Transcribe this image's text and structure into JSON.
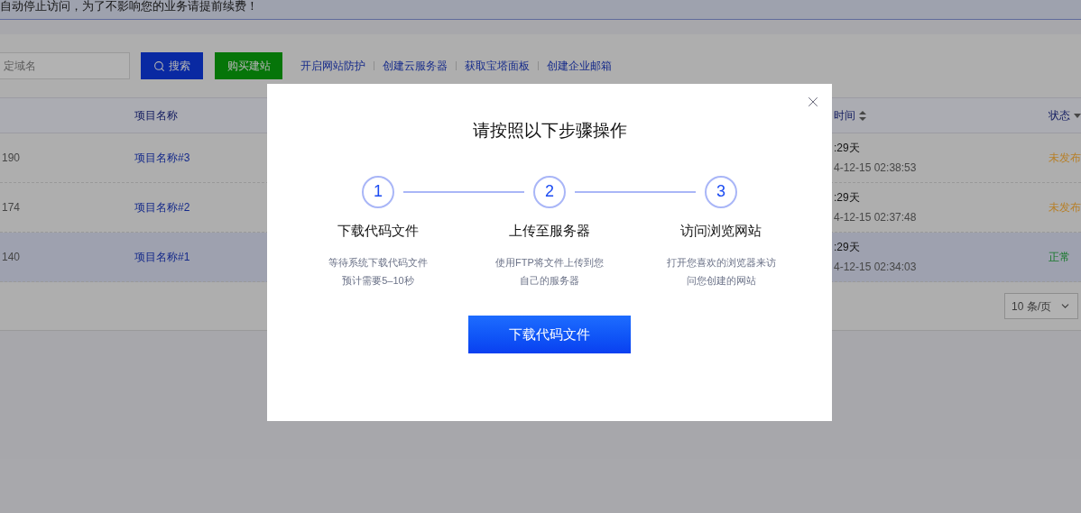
{
  "notice": {
    "text": "自动停止访问，为了不影响您的业务请提前续费！"
  },
  "toolbar": {
    "search": {
      "placeholder": "定域名"
    },
    "search_button": "搜索",
    "buy_button": "购买建站",
    "links": [
      "开启网站防护",
      "创建云服务器",
      "获取宝塔面板",
      "创建企业邮箱"
    ]
  },
  "table": {
    "columns": [
      {
        "label": "项目名称",
        "kind": "plain"
      },
      {
        "label": "时间",
        "kind": "sort"
      },
      {
        "label": "状态",
        "kind": "filter"
      }
    ],
    "rows": [
      {
        "id": "190",
        "name": "项目名称#3",
        "duration": ":29天",
        "created": "4-12-15 02:38:53",
        "status": "未发布",
        "color": "#b7812b",
        "selected": false
      },
      {
        "id": "174",
        "name": "项目名称#2",
        "duration": ":29天",
        "created": "4-12-15 02:37:48",
        "status": "未发布",
        "color": "#b7812b",
        "selected": false
      },
      {
        "id": "140",
        "name": "项目名称#1",
        "duration": ":29天",
        "created": "4-12-15 02:34:03",
        "status": "正常",
        "color": "#17782b",
        "selected": true
      }
    ]
  },
  "pagination": {
    "page_size": "10 条/页"
  },
  "dialog": {
    "title": "请按照以下步骤操作",
    "steps": [
      {
        "number": "1",
        "title": "下载代码文件",
        "lines": [
          "等待系统下载代码文件",
          "预计需要5–10秒"
        ]
      },
      {
        "number": "2",
        "title": "上传至服务器",
        "lines": [
          "使用FTP将文件上传到您",
          "自己的服务器"
        ]
      },
      {
        "number": "3",
        "title": "访问浏览网站",
        "lines": [
          "打开您喜欢的浏览器来访",
          "问您创建的网站"
        ]
      }
    ],
    "button": "下载代码文件"
  }
}
